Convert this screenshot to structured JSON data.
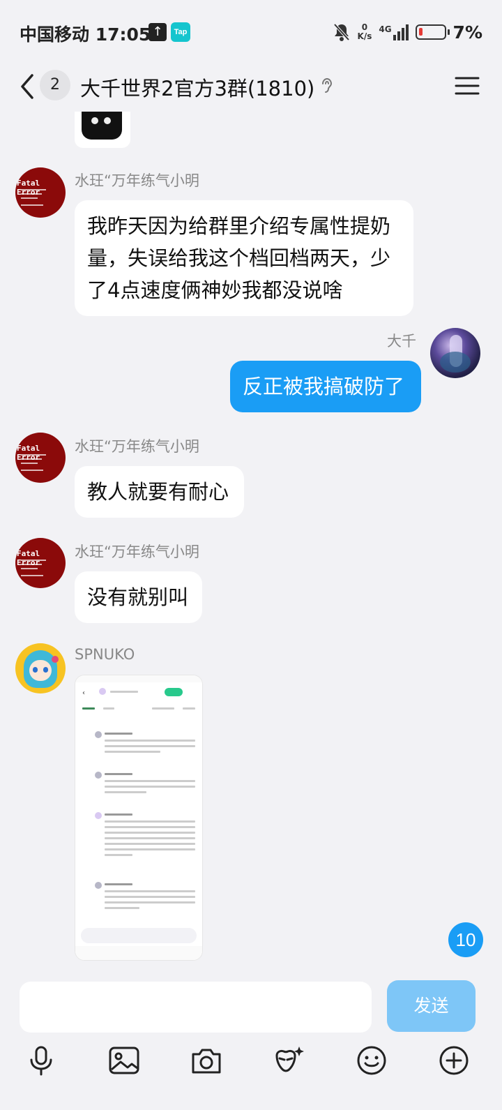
{
  "status_bar": {
    "carrier_time": "中国移动 17:05",
    "tap_label": "Tap",
    "net_speed_value": "0",
    "net_speed_unit": "K/s",
    "network": "4G",
    "battery": "7%"
  },
  "header": {
    "unread_count": "2",
    "title": "大千世界2官方3群(1810)"
  },
  "messages": [
    {
      "sender": "水玨“万年练气小明",
      "text": "我昨天因为给群里介绍专属性提奶量，失误给我这个档回档两天，少了4点速度俩神妙我都没说啥"
    },
    {
      "sender": "大千",
      "text": "反正被我搞破防了"
    },
    {
      "sender": "水玨“万年练气小明",
      "text": "教人就要有耐心"
    },
    {
      "sender": "水玨“万年练气小明",
      "text": "没有就别叫"
    },
    {
      "sender": "SPNUKO",
      "text": ""
    }
  ],
  "avatar_fatal_text": "Fatal Error",
  "new_message_count": "10",
  "composer": {
    "send_label": "发送"
  },
  "icons": [
    "back-icon",
    "ear-icon",
    "menu-icon",
    "mic-icon",
    "image-icon",
    "camera-icon",
    "sticker-icon",
    "emoji-icon",
    "plus-icon"
  ],
  "colors": {
    "bubble_self": "#1a9df5",
    "send_disabled": "#7ec6f7",
    "background": "#f2f2f5"
  }
}
